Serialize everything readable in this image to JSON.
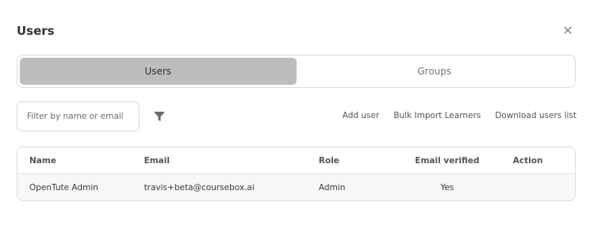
{
  "dialog": {
    "title": "Users"
  },
  "tabs": [
    {
      "label": "Users",
      "active": true
    },
    {
      "label": "Groups",
      "active": false
    }
  ],
  "search": {
    "placeholder": "Filter by name or email",
    "value": ""
  },
  "toolbar": {
    "add_user": "Add user",
    "bulk_import": "Bulk Import Learners",
    "download": "Download users list"
  },
  "table": {
    "headers": {
      "name": "Name",
      "email": "Email",
      "role": "Role",
      "verified": "Email verified",
      "action": "Action"
    },
    "rows": [
      {
        "name": "OpenTute Admin",
        "email": "travis+beta@coursebox.ai",
        "role": "Admin",
        "verified": "Yes",
        "action": ""
      }
    ]
  },
  "icons": {
    "close": "close-icon",
    "filter": "filter-icon"
  },
  "colors": {
    "active_tab": "#bdbdbd",
    "border": "#dcdcdc",
    "row_bg": "#f7f7f7"
  }
}
